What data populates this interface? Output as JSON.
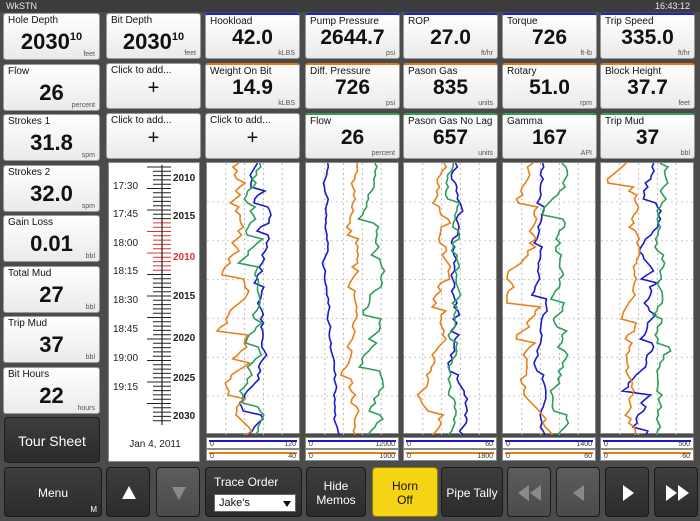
{
  "window": {
    "app": "WkSTN",
    "clock": "16:43:12"
  },
  "left_tiles": [
    {
      "label": "Hole Depth",
      "value": "2030",
      "sup": "10",
      "unit": "feet"
    },
    {
      "label": "Flow",
      "value": "26",
      "unit": "percent"
    },
    {
      "label": "Strokes 1",
      "value": "31.8",
      "unit": "spm"
    },
    {
      "label": "Strokes 2",
      "value": "32.0",
      "unit": "spm"
    },
    {
      "label": "Gain Loss",
      "value": "0.01",
      "unit": "bbl"
    },
    {
      "label": "Total Mud",
      "value": "27",
      "unit": "bbl"
    },
    {
      "label": "Trip Mud",
      "value": "37",
      "unit": "bbl"
    },
    {
      "label": "Bit Hours",
      "value": "22",
      "unit": "hours"
    }
  ],
  "bit_depth": {
    "label": "Bit Depth",
    "value": "2030",
    "sup": "10",
    "unit": "feet"
  },
  "add_tile_label": "Click to add...",
  "add_tile_plus": "+",
  "row1": [
    {
      "label": "Hookload",
      "value": "42.0",
      "unit": "kLBS",
      "color": "#2222cc"
    },
    {
      "label": "Pump Pressure",
      "value": "2644.7",
      "unit": "psi",
      "color": "#2222cc"
    },
    {
      "label": "ROP",
      "value": "27.0",
      "unit": "ft/hr",
      "color": "#2222cc"
    },
    {
      "label": "Torque",
      "value": "726",
      "unit": "ft-lb",
      "color": "#2222cc"
    },
    {
      "label": "Trip Speed",
      "value": "335.0",
      "unit": "ft/hr",
      "color": "#2222cc"
    }
  ],
  "row2": [
    {
      "label": "Weight On Bit",
      "value": "14.9",
      "unit": "kLBS",
      "color": "#e07b20"
    },
    {
      "label": "Diff. Pressure",
      "value": "726",
      "unit": "psi",
      "color": "#e07b20"
    },
    {
      "label": "Pason Gas",
      "value": "835",
      "unit": "units",
      "color": "#e07b20"
    },
    {
      "label": "Rotary",
      "value": "51.0",
      "unit": "rpm",
      "color": "#e07b20"
    },
    {
      "label": "Block Height",
      "value": "37.7",
      "unit": "feet",
      "color": "#e07b20"
    }
  ],
  "row3": [
    {
      "label": "Flow",
      "value": "26",
      "unit": "percent",
      "color": "#2e9e5a"
    },
    {
      "label": "Pason Gas No Lag",
      "value": "657",
      "unit": "units",
      "color": "#2e9e5a"
    },
    {
      "label": "Gamma",
      "value": "167",
      "unit": "API",
      "color": "#2e9e5a"
    },
    {
      "label": "Trip Mud",
      "value": "37",
      "unit": "bbl",
      "color": "#2e9e5a"
    }
  ],
  "depth_track": {
    "times": [
      "17:30",
      "17:45",
      "18:00",
      "18:15",
      "18:30",
      "18:45",
      "19:00",
      "19:15"
    ],
    "depths": [
      "2010",
      "2015",
      "2010",
      "2015",
      "2020",
      "2025",
      "2030"
    ],
    "date": "Jan 4, 2011"
  },
  "scales": [
    {
      "blue": [
        "0",
        "120"
      ],
      "orange": [
        "0",
        "40"
      ]
    },
    {
      "blue": [
        "0",
        "12000"
      ],
      "orange": [
        "0",
        "1000"
      ]
    },
    {
      "blue": [
        "0",
        "60"
      ],
      "orange": [
        "0",
        "1800"
      ]
    },
    {
      "blue": [
        "0",
        "1400"
      ],
      "orange": [
        "0",
        "60"
      ]
    },
    {
      "blue": [
        "0",
        "500"
      ],
      "orange": [
        "0",
        "60"
      ]
    }
  ],
  "colors": {
    "blue": "#1a1acc",
    "orange": "#e8801a",
    "green": "#2e9e5a",
    "red": "#e03030",
    "horn": "#f5d416"
  },
  "tour_sheet": "Tour Sheet",
  "bottom": {
    "menu": "Menu",
    "menu_badge": "M",
    "trace_order_label": "Trace Order",
    "trace_order_value": "Jake's",
    "hide_memos": [
      "Hide",
      "Memos"
    ],
    "horn_off": [
      "Horn",
      "Off"
    ],
    "pipe_tally": "Pipe Tally"
  }
}
